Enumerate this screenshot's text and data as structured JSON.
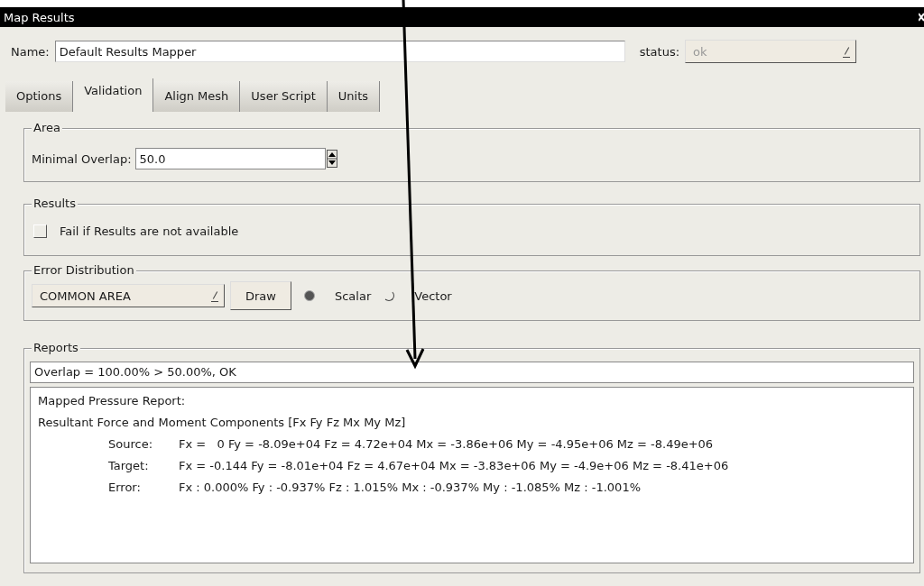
{
  "window": {
    "title": "Map Results"
  },
  "name_row": {
    "label": "Name:",
    "value": "Default Results Mapper",
    "status_label": "status:",
    "status_value": "ok",
    "status_disabled": true
  },
  "tabs": [
    {
      "label": "Options",
      "selected": false
    },
    {
      "label": "Validation",
      "selected": true
    },
    {
      "label": "Align Mesh",
      "selected": false
    },
    {
      "label": "User Script",
      "selected": false
    },
    {
      "label": "Units",
      "selected": false
    }
  ],
  "area": {
    "title": "Area",
    "label": "Minimal Overlap:",
    "value": "50.0"
  },
  "results": {
    "title": "Results",
    "checkbox": {
      "label": "Fail if Results are not available",
      "checked": false
    }
  },
  "error_distribution": {
    "title": "Error Distribution",
    "dropdown": "COMMON AREA",
    "button": "Draw",
    "radios": [
      {
        "label": "Scalar",
        "selected": true
      },
      {
        "label": "Vector",
        "selected": false
      }
    ]
  },
  "reports": {
    "title": "Reports",
    "summary": "Overlap = 100.00% > 50.00%, OK",
    "headings": [
      "Mapped Pressure Report:",
      "Resultant Force and Moment Components [Fx Fy Fz Mx My Mz]"
    ],
    "rows": [
      {
        "label": "Source:",
        "value": "Fx =   0 Fy = -8.09e+04 Fz = 4.72e+04 Mx = -3.86e+06 My = -4.95e+06 Mz = -8.49e+06"
      },
      {
        "label": "Target:",
        "value": "Fx = -0.144 Fy = -8.01e+04 Fz = 4.67e+04 Mx = -3.83e+06 My = -4.9e+06 Mz = -8.41e+06"
      },
      {
        "label": "Error:",
        "value": "Fx : 0.000% Fy : -0.937% Fz : 1.015% Mx : -0.937% My : -1.085% Mz : -1.001%"
      }
    ]
  }
}
